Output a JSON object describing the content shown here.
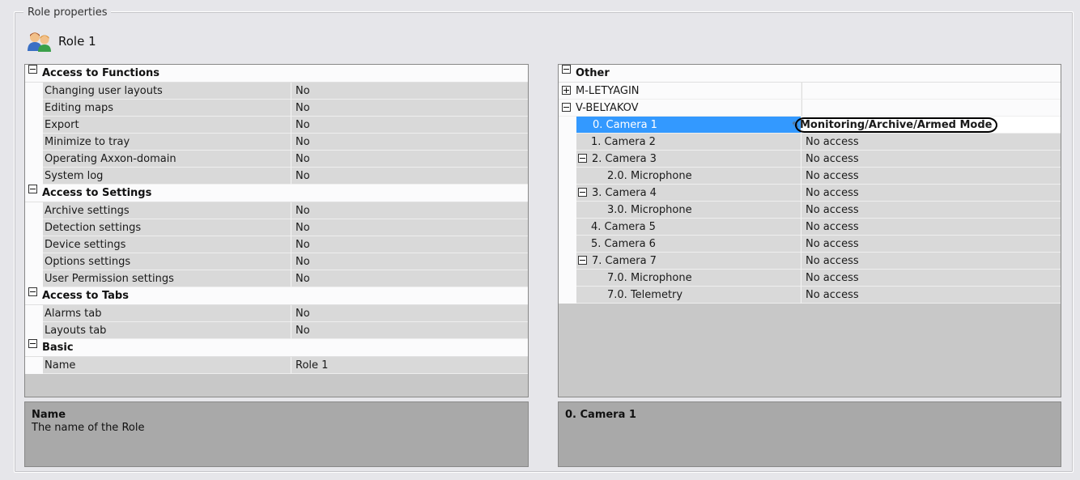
{
  "group_title": "Role properties",
  "role": {
    "name": "Role 1",
    "icon": "users-icon"
  },
  "left_grid": {
    "categories": [
      {
        "label": "Access to Functions",
        "rows": [
          {
            "name": "Changing user layouts",
            "value": "No"
          },
          {
            "name": "Editing maps",
            "value": "No"
          },
          {
            "name": "Export",
            "value": "No"
          },
          {
            "name": "Minimize to tray",
            "value": "No"
          },
          {
            "name": "Operating Axxon-domain",
            "value": "No"
          },
          {
            "name": "System log",
            "value": "No"
          }
        ]
      },
      {
        "label": "Access to Settings",
        "rows": [
          {
            "name": "Archive settings",
            "value": "No"
          },
          {
            "name": "Detection settings",
            "value": "No"
          },
          {
            "name": "Device settings",
            "value": "No"
          },
          {
            "name": "Options settings",
            "value": "No"
          },
          {
            "name": "User Permission settings",
            "value": "No"
          }
        ]
      },
      {
        "label": "Access to Tabs",
        "rows": [
          {
            "name": "Alarms tab",
            "value": "No"
          },
          {
            "name": "Layouts tab",
            "value": "No"
          }
        ]
      },
      {
        "label": "Basic",
        "rows": [
          {
            "name": "Name",
            "value": "Role 1"
          }
        ]
      }
    ]
  },
  "left_description": {
    "title": "Name",
    "text": "The name of the Role"
  },
  "right_grid": {
    "category": "Other",
    "rows": [
      {
        "name": "M-LETYAGIN",
        "value": "",
        "level": 0,
        "expander": "plus"
      },
      {
        "name": "V-BELYAKOV",
        "value": "",
        "level": 0,
        "expander": "minus"
      },
      {
        "name": "0. Camera 1",
        "value": "Monitoring/Archive/Armed Mode",
        "level": 1,
        "expander": "",
        "selected": true
      },
      {
        "name": "1. Camera 2",
        "value": "No access",
        "level": 1,
        "expander": ""
      },
      {
        "name": "2. Camera 3",
        "value": "No access",
        "level": 1,
        "expander": "minus"
      },
      {
        "name": "2.0. Microphone",
        "value": "No access",
        "level": 2,
        "expander": ""
      },
      {
        "name": "3. Camera 4",
        "value": "No access",
        "level": 1,
        "expander": "minus"
      },
      {
        "name": "3.0. Microphone",
        "value": "No access",
        "level": 2,
        "expander": ""
      },
      {
        "name": "4. Camera 5",
        "value": "No access",
        "level": 1,
        "expander": ""
      },
      {
        "name": "5. Camera 6",
        "value": "No access",
        "level": 1,
        "expander": ""
      },
      {
        "name": "7. Camera 7",
        "value": "No access",
        "level": 1,
        "expander": "minus"
      },
      {
        "name": "7.0. Microphone",
        "value": "No access",
        "level": 2,
        "expander": ""
      },
      {
        "name": "7.0. Telemetry",
        "value": "No access",
        "level": 2,
        "expander": ""
      }
    ]
  },
  "right_description": {
    "title": "0. Camera 1",
    "text": ""
  },
  "colors": {
    "selection": "#3399ff",
    "panel": "#d9d9d9",
    "description": "#a9a9a9"
  }
}
